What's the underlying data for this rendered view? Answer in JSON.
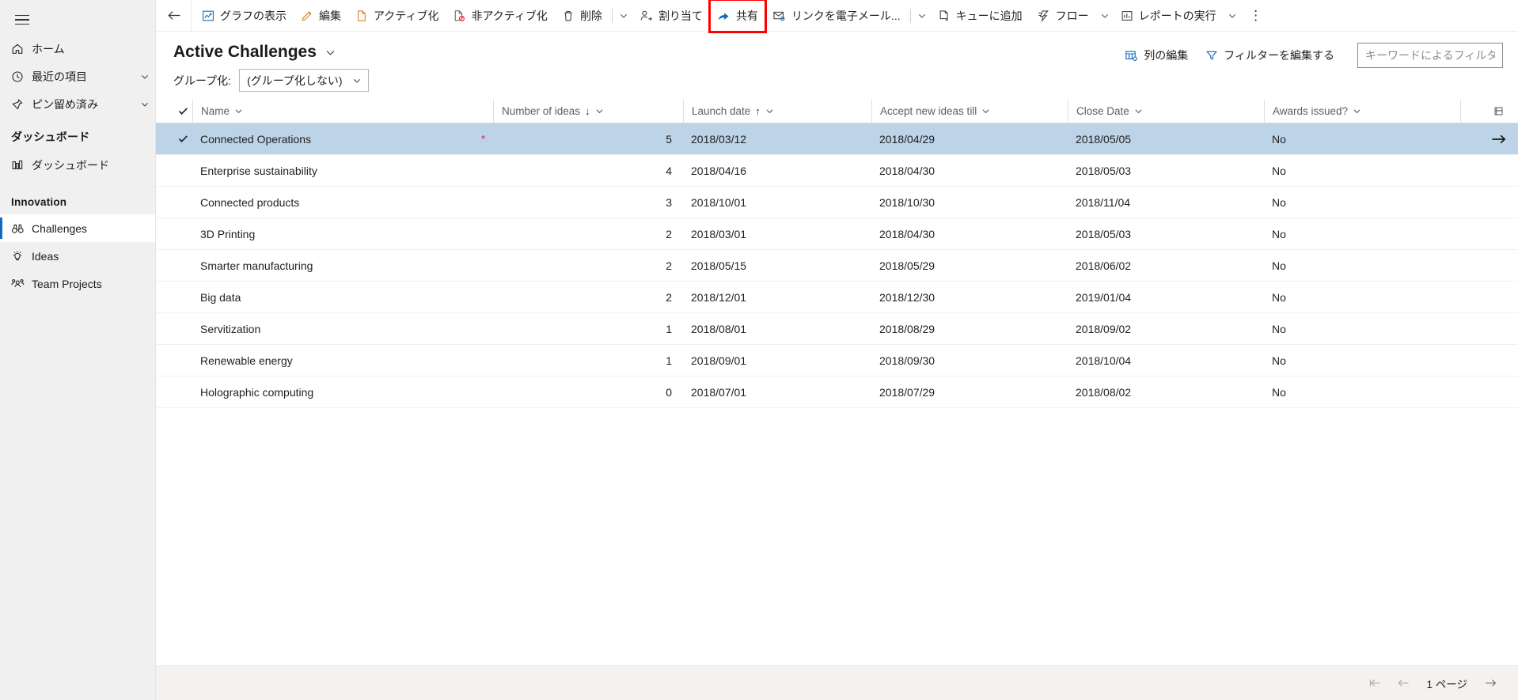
{
  "sidebar": {
    "menu_icon": "hamburger-icon",
    "items": [
      {
        "label": "ホーム",
        "icon": "home-icon",
        "chevron": false
      },
      {
        "label": "最近の項目",
        "icon": "clock-icon",
        "chevron": true
      },
      {
        "label": "ピン留め済み",
        "icon": "pin-icon",
        "chevron": true
      }
    ],
    "groups": [
      {
        "title": "ダッシュボード",
        "items": [
          {
            "label": "ダッシュボード",
            "icon": "dashboard-icon",
            "selected": false
          }
        ]
      },
      {
        "title": "Innovation",
        "items": [
          {
            "label": "Challenges",
            "icon": "binoculars-icon",
            "selected": true
          },
          {
            "label": "Ideas",
            "icon": "lightbulb-icon",
            "selected": false
          },
          {
            "label": "Team Projects",
            "icon": "people-icon",
            "selected": false
          }
        ]
      }
    ]
  },
  "commandbar": {
    "back_icon": "back-arrow-icon",
    "overflow_label": "⋮",
    "buttons": [
      {
        "label": "グラフの表示",
        "icon": "chart-icon",
        "highlighted": false
      },
      {
        "label": "編集",
        "icon": "pencil-icon",
        "highlighted": false
      },
      {
        "label": "アクティブ化",
        "icon": "activate-document-icon",
        "highlighted": false
      },
      {
        "label": "非アクティブ化",
        "icon": "deactivate-document-icon",
        "highlighted": false
      },
      {
        "label": "削除",
        "icon": "trash-icon",
        "highlighted": false,
        "divider_after": true,
        "caret_after": true
      },
      {
        "label": "割り当て",
        "icon": "assign-user-icon",
        "highlighted": false
      },
      {
        "label": "共有",
        "icon": "share-icon",
        "highlighted": true
      },
      {
        "label": "リンクを電子メール...",
        "icon": "email-link-icon",
        "highlighted": false,
        "divider_after": true,
        "caret_after": true
      },
      {
        "label": "キューに追加",
        "icon": "add-to-queue-icon",
        "highlighted": false
      },
      {
        "label": "フロー",
        "icon": "flow-icon",
        "highlighted": false,
        "caret_after": true
      },
      {
        "label": "レポートの実行",
        "icon": "report-icon",
        "highlighted": false,
        "caret_after": true
      }
    ]
  },
  "view": {
    "title": "Active Challenges",
    "title_caret": "chevron-down-icon",
    "actions": [
      {
        "label": "列の編集",
        "icon": "edit-columns-icon"
      },
      {
        "label": "フィルターを編集する",
        "icon": "filter-icon"
      }
    ],
    "search": {
      "placeholder": "キーワードによるフィルタ",
      "value": ""
    },
    "groupby": {
      "label": "グループ化:",
      "selected": "(グループ化しない)",
      "caret": "chevron-down-icon"
    }
  },
  "grid": {
    "select_all_icon": "checkmark-icon",
    "end_icon": "column-options-icon",
    "columns": [
      {
        "key": "name",
        "label": "Name",
        "sort": "",
        "caret": "chevron-down-icon",
        "align": "left"
      },
      {
        "key": "ideas",
        "label": "Number of ideas",
        "sort": "↓",
        "caret": "chevron-down-icon",
        "align": "right"
      },
      {
        "key": "launch",
        "label": "Launch date",
        "sort": "↑",
        "caret": "chevron-down-icon",
        "align": "left"
      },
      {
        "key": "accept",
        "label": "Accept new ideas till",
        "sort": "",
        "caret": "chevron-down-icon",
        "align": "left"
      },
      {
        "key": "close",
        "label": "Close Date",
        "sort": "",
        "caret": "chevron-down-icon",
        "align": "left"
      },
      {
        "key": "awards",
        "label": "Awards issued?",
        "sort": "",
        "caret": "chevron-down-icon",
        "align": "left"
      }
    ],
    "rows": [
      {
        "name": "Connected Operations",
        "flag": "*",
        "ideas": "5",
        "launch": "2018/03/12",
        "accept": "2018/04/29",
        "close": "2018/05/05",
        "awards": "No",
        "selected": true
      },
      {
        "name": "Enterprise sustainability",
        "flag": "",
        "ideas": "4",
        "launch": "2018/04/16",
        "accept": "2018/04/30",
        "close": "2018/05/03",
        "awards": "No",
        "selected": false
      },
      {
        "name": "Connected products",
        "flag": "",
        "ideas": "3",
        "launch": "2018/10/01",
        "accept": "2018/10/30",
        "close": "2018/11/04",
        "awards": "No",
        "selected": false
      },
      {
        "name": "3D Printing",
        "flag": "",
        "ideas": "2",
        "launch": "2018/03/01",
        "accept": "2018/04/30",
        "close": "2018/05/03",
        "awards": "No",
        "selected": false
      },
      {
        "name": "Smarter manufacturing",
        "flag": "",
        "ideas": "2",
        "launch": "2018/05/15",
        "accept": "2018/05/29",
        "close": "2018/06/02",
        "awards": "No",
        "selected": false
      },
      {
        "name": "Big data",
        "flag": "",
        "ideas": "2",
        "launch": "2018/12/01",
        "accept": "2018/12/30",
        "close": "2019/01/04",
        "awards": "No",
        "selected": false
      },
      {
        "name": "Servitization",
        "flag": "",
        "ideas": "1",
        "launch": "2018/08/01",
        "accept": "2018/08/29",
        "close": "2018/09/02",
        "awards": "No",
        "selected": false
      },
      {
        "name": "Renewable energy",
        "flag": "",
        "ideas": "1",
        "launch": "2018/09/01",
        "accept": "2018/09/30",
        "close": "2018/10/04",
        "awards": "No",
        "selected": false
      },
      {
        "name": "Holographic computing",
        "flag": "",
        "ideas": "0",
        "launch": "2018/07/01",
        "accept": "2018/07/29",
        "close": "2018/08/02",
        "awards": "No",
        "selected": false
      }
    ]
  },
  "footer": {
    "page_label": "1 ページ",
    "first_icon": "page-first-icon",
    "prev_icon": "page-prev-icon",
    "next_icon": "page-next-icon"
  },
  "colors": {
    "accent": "#0f6cbd",
    "selected_row": "#bcd3e8",
    "highlight_outline": "#ff0000",
    "flag_red": "#e8112d"
  }
}
